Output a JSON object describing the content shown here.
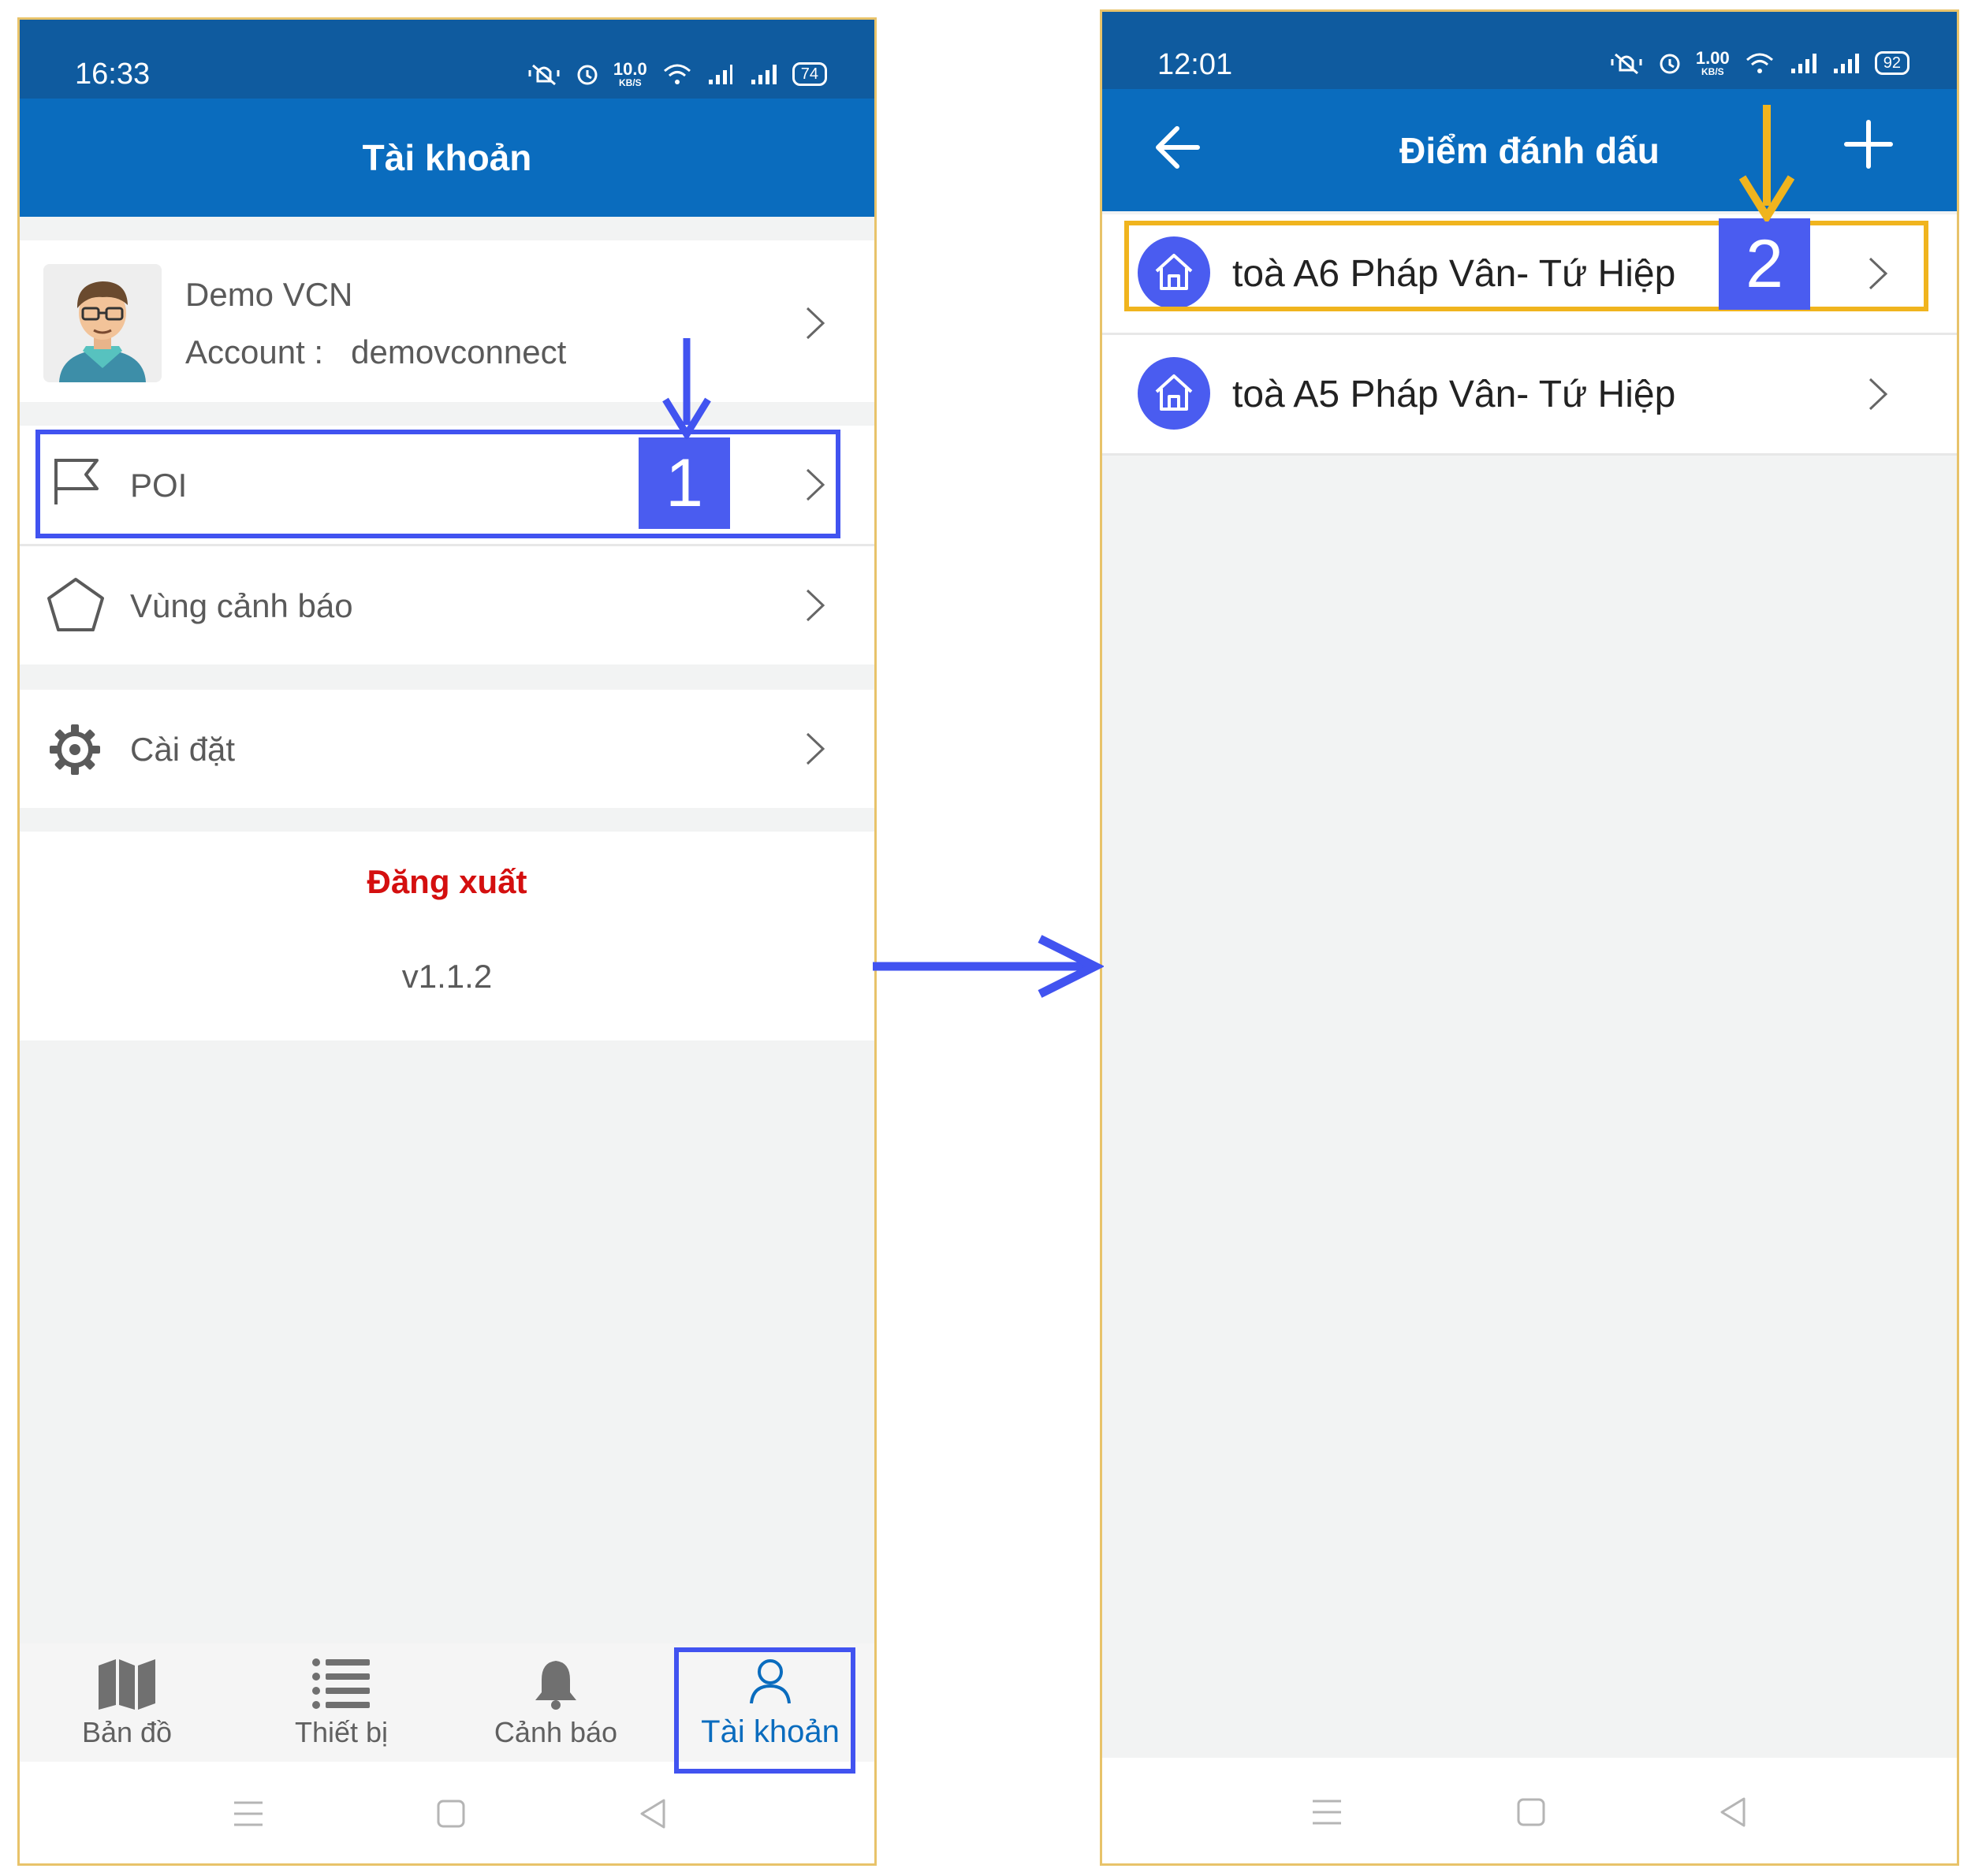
{
  "left": {
    "status": {
      "time": "16:33",
      "net_value": "10.0",
      "net_unit": "KB/S",
      "battery": "74"
    },
    "title": "Tài khoản",
    "profile": {
      "name": "Demo VCN",
      "account_label": "Account :",
      "account_value": "demovconnect"
    },
    "menu": [
      {
        "label": "POI",
        "icon": "flag-icon"
      },
      {
        "label": "Vùng cảnh báo",
        "icon": "pentagon-icon"
      },
      {
        "label": "Cài đặt",
        "icon": "gear-icon"
      }
    ],
    "logout": "Đăng xuất",
    "version": "v1.1.2",
    "tabs": [
      {
        "label": "Bản đồ",
        "icon": "map-icon"
      },
      {
        "label": "Thiết bị",
        "icon": "list-icon"
      },
      {
        "label": "Cảnh báo",
        "icon": "bell-icon"
      },
      {
        "label": "Tài khoản",
        "icon": "user-icon",
        "active": true
      }
    ],
    "step_badge": "1"
  },
  "right": {
    "status": {
      "time": "12:01",
      "net_value": "1.00",
      "net_unit": "KB/S",
      "battery": "92"
    },
    "title": "Điểm đánh dấu",
    "items": [
      {
        "label": "toà A6 Pháp Vân- Tứ Hiệp",
        "icon": "home-icon"
      },
      {
        "label": "toà A5 Pháp Vân- Tứ Hiệp",
        "icon": "home-icon"
      }
    ],
    "step_badge": "2"
  },
  "colors": {
    "status_bar": "#0f5b9f",
    "app_bar": "#0a6cbe",
    "highlight_blue": "#4153f0",
    "highlight_gold": "#f0b41e",
    "logout_red": "#d40f0f",
    "background": "#f2f3f3"
  }
}
